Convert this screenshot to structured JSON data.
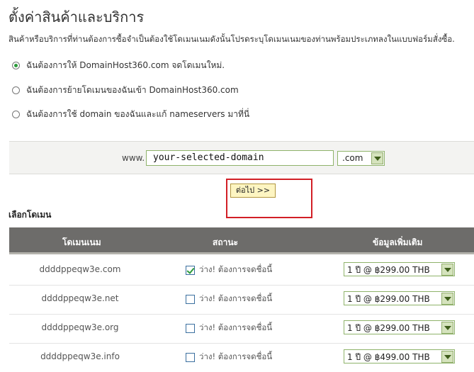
{
  "page": {
    "title": "ตั้งค่าสินค้าและบริการ",
    "intro": "สินค้าหรือบริการที่ท่านต้องการซื้อจำเป็นต้องใช้โดเมนเนมดังนั้นโปรดระบุโดเมนเนมของท่านพร้อมประเภทลงในแบบฟอร์มสั่งซื้อ."
  },
  "options": [
    {
      "label": "ฉันต้องการให้ DomainHost360.com จดโดเมนใหม่.",
      "selected": true
    },
    {
      "label": "ฉันต้องการย้ายโดเมนของฉันเข้า DomainHost360.com",
      "selected": false
    },
    {
      "label": "ฉันต้องการใช้ domain ของฉันและแก้ nameservers มาที่นี่",
      "selected": false
    }
  ],
  "domain_form": {
    "prefix": "www.",
    "value": "your-selected-domain",
    "tld": ".com"
  },
  "next_button": "ต่อไป >>",
  "section_title": "เลือกโดเมน",
  "table": {
    "headers": [
      "โดเมนเนม",
      "สถานะ",
      "ข้อมูลเพิ่มเติม"
    ],
    "rows": [
      {
        "domain": "ddddppeqw3e.com",
        "checked": true,
        "status": "ว่าง! ต้องการจดชื่อนี้",
        "price": "1 ปี @ ฿299.00 THB"
      },
      {
        "domain": "ddddppeqw3e.net",
        "checked": false,
        "status": "ว่าง! ต้องการจดชื่อนี้",
        "price": "1 ปี @ ฿299.00 THB"
      },
      {
        "domain": "ddddppeqw3e.org",
        "checked": false,
        "status": "ว่าง! ต้องการจดชื่อนี้",
        "price": "1 ปี @ ฿299.00 THB"
      },
      {
        "domain": "ddddppeqw3e.info",
        "checked": false,
        "status": "ว่าง! ต้องการจดชื่อนี้",
        "price": "1 ปี @ ฿499.00 THB"
      }
    ]
  },
  "colors": {
    "header_bg": "#6d6c6a",
    "highlight_border": "#d21f26",
    "button_bg": "#fdf5c2",
    "select_border": "#8fb36a"
  }
}
